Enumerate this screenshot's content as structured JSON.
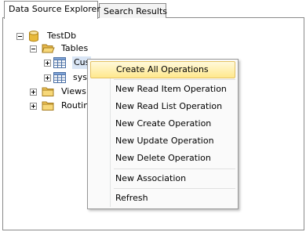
{
  "tabs": [
    {
      "label": "Data Source Explorer",
      "active": true
    },
    {
      "label": "Search Results",
      "active": false
    }
  ],
  "tree": {
    "root": {
      "label": "TestDb",
      "icon": "database-icon",
      "expanded": true
    },
    "tables": {
      "label": "Tables",
      "icon": "open-folder-icon",
      "expanded": true
    },
    "tables_children": [
      {
        "label": "Cus",
        "icon": "table-icon",
        "selected": true
      },
      {
        "label": "sysc",
        "icon": "table-icon",
        "selected": false
      }
    ],
    "views": {
      "label": "Views",
      "icon": "folder-icon",
      "expanded": false
    },
    "routines": {
      "label": "Routin",
      "icon": "folder-icon",
      "expanded": false
    }
  },
  "context_menu": {
    "items": [
      {
        "label": "Create All Operations",
        "highlighted": true
      },
      {
        "label": "New Read Item Operation"
      },
      {
        "label": "New Read List Operation"
      },
      {
        "label": "New Create Operation"
      },
      {
        "label": "New Update Operation"
      },
      {
        "label": "New Delete Operation"
      },
      {
        "label": "New Association"
      },
      {
        "label": "Refresh"
      }
    ]
  },
  "colors": {
    "menu_highlight": "#ffe88c",
    "selection": "#d9e5f5",
    "folder": "#f2c75c",
    "database": "#e8b93a"
  }
}
